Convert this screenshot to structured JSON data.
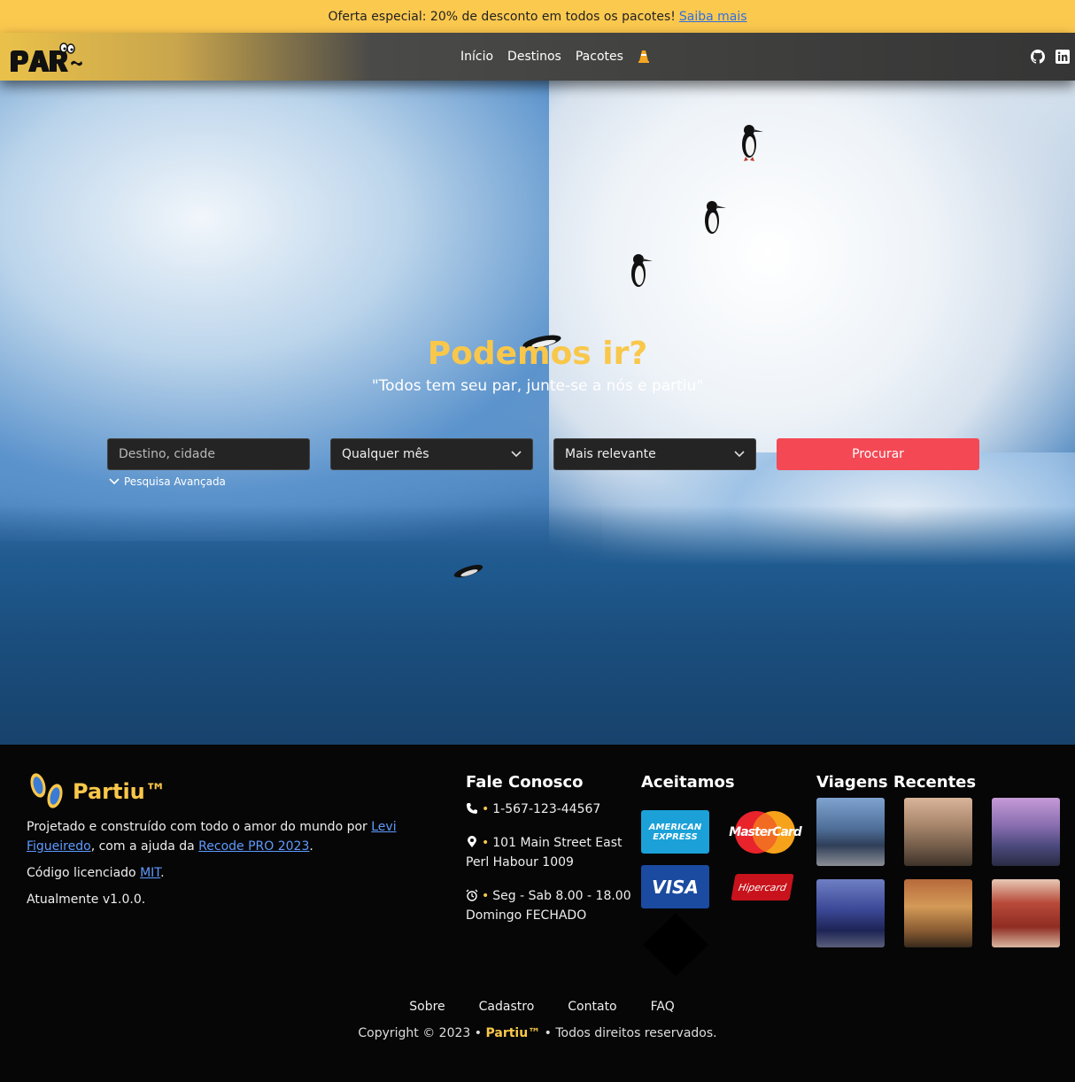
{
  "promo": {
    "text": "Oferta especial: 20% de desconto em todos os pacotes!",
    "link": "Saiba mais"
  },
  "header": {
    "nav": [
      {
        "label": "Início"
      },
      {
        "label": "Destinos"
      },
      {
        "label": "Pacotes"
      }
    ],
    "icons": [
      "traffic-cone-icon",
      "github-icon",
      "linkedin-icon"
    ]
  },
  "hero": {
    "title": "Podemos ir?",
    "subtitle": "\"Todos tem seu par, junte-se a nós e partiu\"",
    "search": {
      "destination_placeholder": "Destino, cidade",
      "month_value": "Qualquer mês",
      "sort_value": "Mais relevante",
      "button": "Procurar"
    },
    "advanced": "Pesquisa Avançada"
  },
  "footer": {
    "brand": "Partiu™",
    "about": {
      "line1_prefix": "Projetado e construído com todo o amor do mundo por",
      "author": "Levi Figueiredo",
      "line1_mid": ", com a ajuda da",
      "helper": "Recode PRO 2023",
      "line1_end": ".",
      "license_prefix": "Código licenciado",
      "license": "MIT",
      "license_end": ".",
      "version": "Atualmente v1.0.0."
    },
    "contact": {
      "title": "Fale Conosco",
      "phone": "1-567-123-44567",
      "address1": "101 Main Street East",
      "address2": "Perl Habour 1009",
      "hours1": "Seg - Sab 8.00 - 18.00",
      "hours2": "Domingo FECHADO"
    },
    "payments": {
      "title": "Aceitamos",
      "amex_line1": "AMERICAN",
      "amex_line2": "EXPRESS",
      "mastercard": "MasterCard",
      "visa": "VISA",
      "hipercard": "Hipercard"
    },
    "recent": {
      "title": "Viagens Recentes"
    },
    "links": [
      {
        "label": "Sobre"
      },
      {
        "label": "Cadastro"
      },
      {
        "label": "Contato"
      },
      {
        "label": "FAQ"
      }
    ],
    "copyright": {
      "prefix": "Copyright © 2023 •",
      "brand": "Partiu™",
      "suffix": "• Todos direitos reservados."
    }
  },
  "colors": {
    "accent": "#f9c74a",
    "promo_bg": "#fcc94f",
    "button": "#f44855",
    "link": "#5f9bff"
  }
}
